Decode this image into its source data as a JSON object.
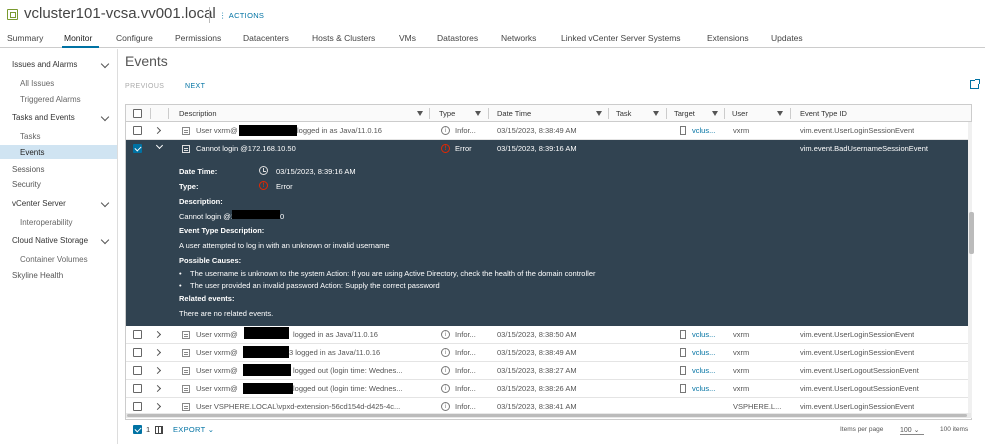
{
  "header": {
    "title": "vcluster101-vcsa.vv001.local",
    "actions_label": "ACTIONS",
    "icon": "datacenter-icon"
  },
  "tabs": [
    {
      "label": "Summary"
    },
    {
      "label": "Monitor"
    },
    {
      "label": "Configure"
    },
    {
      "label": "Permissions"
    },
    {
      "label": "Datacenters"
    },
    {
      "label": "Hosts & Clusters"
    },
    {
      "label": "VMs"
    },
    {
      "label": "Datastores"
    },
    {
      "label": "Networks"
    },
    {
      "label": "Linked vCenter Server Systems"
    },
    {
      "label": "Extensions"
    },
    {
      "label": "Updates"
    }
  ],
  "sidebar": {
    "groups": {
      "issues": "Issues and Alarms",
      "all_issues": "All Issues",
      "triggered": "Triggered Alarms",
      "tasks_events": "Tasks and Events",
      "tasks": "Tasks",
      "events": "Events",
      "sessions": "Sessions",
      "security": "Security",
      "vcenter": "vCenter Server",
      "interop": "Interoperability",
      "cns": "Cloud Native Storage",
      "container_volumes": "Container Volumes",
      "skyline": "Skyline Health"
    }
  },
  "main": {
    "title": "Events",
    "previous": "PREVIOUS",
    "next": "NEXT"
  },
  "columns": {
    "description": "Description",
    "type": "Type",
    "date_time": "Date Time",
    "task": "Task",
    "target": "Target",
    "user": "User",
    "event_type_id": "Event Type ID"
  },
  "rows_top": [
    {
      "desc_pre": "User vxrm@",
      "desc_post": "logged in as Java/11.0.16",
      "type": "Infor...",
      "date": "03/15/2023, 8:38:49 AM",
      "target": "vclus...",
      "user": "vxrm",
      "event_id": "vim.event.UserLoginSessionEvent"
    }
  ],
  "expanded": {
    "desc": "Cannot login @172.168.10.50",
    "type": "Error",
    "date": "03/15/2023, 8:39:16 AM",
    "event_id": "vim.event.BadUsernameSessionEvent",
    "details": {
      "date_label": "Date Time:",
      "date_value": "03/15/2023, 8:39:16 AM",
      "type_label": "Type:",
      "type_value": "Error",
      "desc_label": "Description:",
      "desc_pre": "Cannot login @1",
      "desc_post": "0",
      "etd_label": "Event Type Description:",
      "etd_value": "A user attempted to log in with an unknown or invalid username",
      "causes_label": "Possible Causes:",
      "cause1": "The username is unknown to the system Action: If you are using Active Directory, check the health of the domain controller",
      "cause2": "The user provided an invalid password Action: Supply the correct password",
      "related_label": "Related events:",
      "related_value": "There are no related events."
    }
  },
  "rows_bottom": [
    {
      "desc_pre": "User vxrm@",
      "desc_post": "logged in as Java/11.0.16",
      "type": "Infor...",
      "date": "03/15/2023, 8:38:50 AM",
      "target": "vclus...",
      "user": "vxrm",
      "event_id": "vim.event.UserLoginSessionEvent"
    },
    {
      "desc_pre": "User vxrm@",
      "desc_post": "3 logged in as Java/11.0.16",
      "type": "Infor...",
      "date": "03/15/2023, 8:38:49 AM",
      "target": "vclus...",
      "user": "vxrm",
      "event_id": "vim.event.UserLoginSessionEvent"
    },
    {
      "desc_pre": "User vxrm@",
      "desc_post": "logged out (login time: Wednes...",
      "type": "Infor...",
      "date": "03/15/2023, 8:38:27 AM",
      "target": "vclus...",
      "user": "vxrm",
      "event_id": "vim.event.UserLogoutSessionEvent"
    },
    {
      "desc_pre": "User vxrm@",
      "desc_post": "logged out (login time: Wednes...",
      "type": "Infor...",
      "date": "03/15/2023, 8:38:26 AM",
      "target": "vclus...",
      "user": "vxrm",
      "event_id": "vim.event.UserLogoutSessionEvent"
    },
    {
      "desc_pre": "User VSPHERE.LOCAL\\vpxd-extension-56cd154d-d425-4c...",
      "desc_post": "",
      "type": "Infor...",
      "date": "03/15/2023, 8:38:41 AM",
      "target": "",
      "user": "VSPHERE.L...",
      "event_id": "vim.event.UserLoginSessionEvent"
    }
  ],
  "footer": {
    "selected_count": "1",
    "export": "EXPORT",
    "items_per_page_label": "Items per page",
    "items_per_page_value": "100",
    "total": "100 items"
  },
  "colors": {
    "accent": "#0072a3",
    "expanded_bg": "#314351",
    "error": "#e62700",
    "sidebar_active": "#d0e4f2"
  }
}
